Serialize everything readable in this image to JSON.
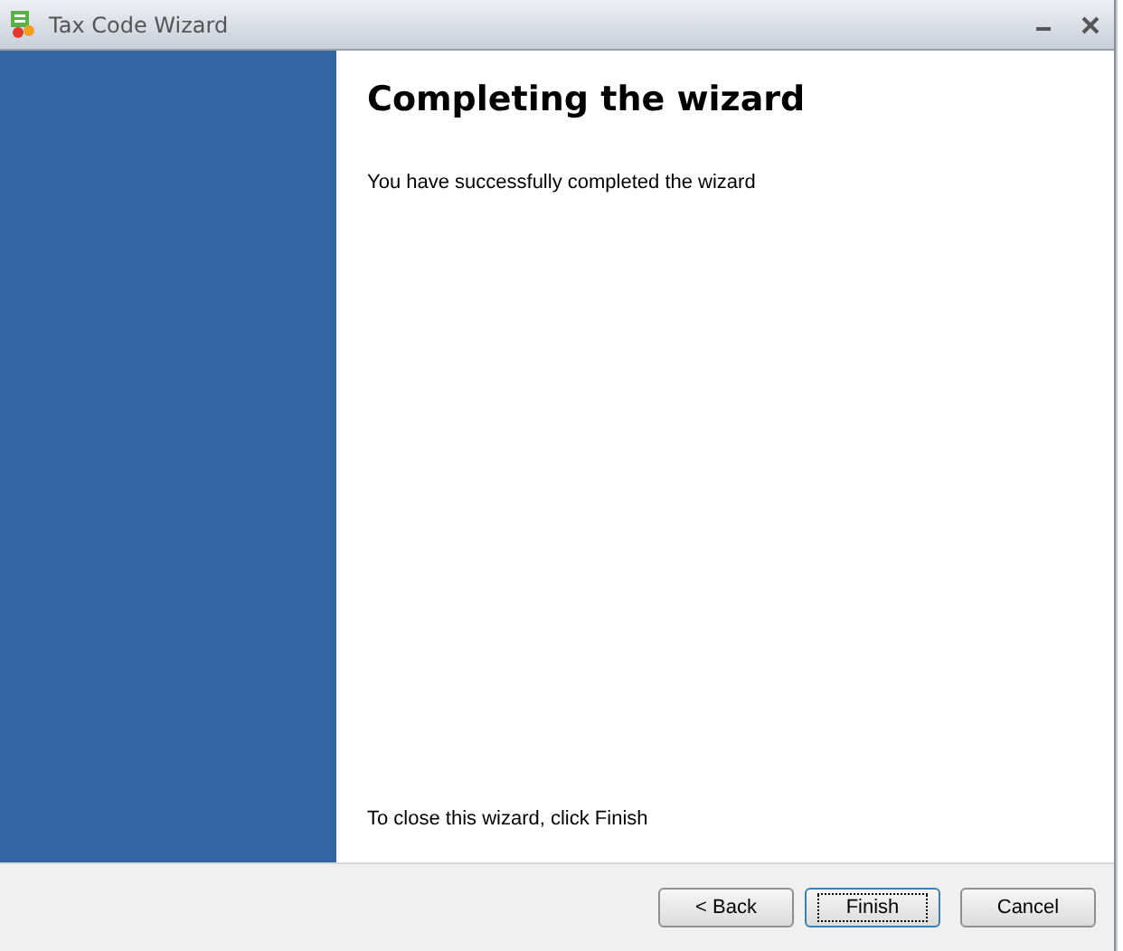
{
  "window": {
    "title": "Tax Code Wizard"
  },
  "page": {
    "heading": "Completing the wizard",
    "message": "You have successfully completed the wizard",
    "footer_note": "To close this wizard, click Finish"
  },
  "buttons": [
    {
      "label": "< Back",
      "focused": false
    },
    {
      "label": "Finish",
      "focused": true
    },
    {
      "label": "Cancel",
      "focused": false
    }
  ]
}
